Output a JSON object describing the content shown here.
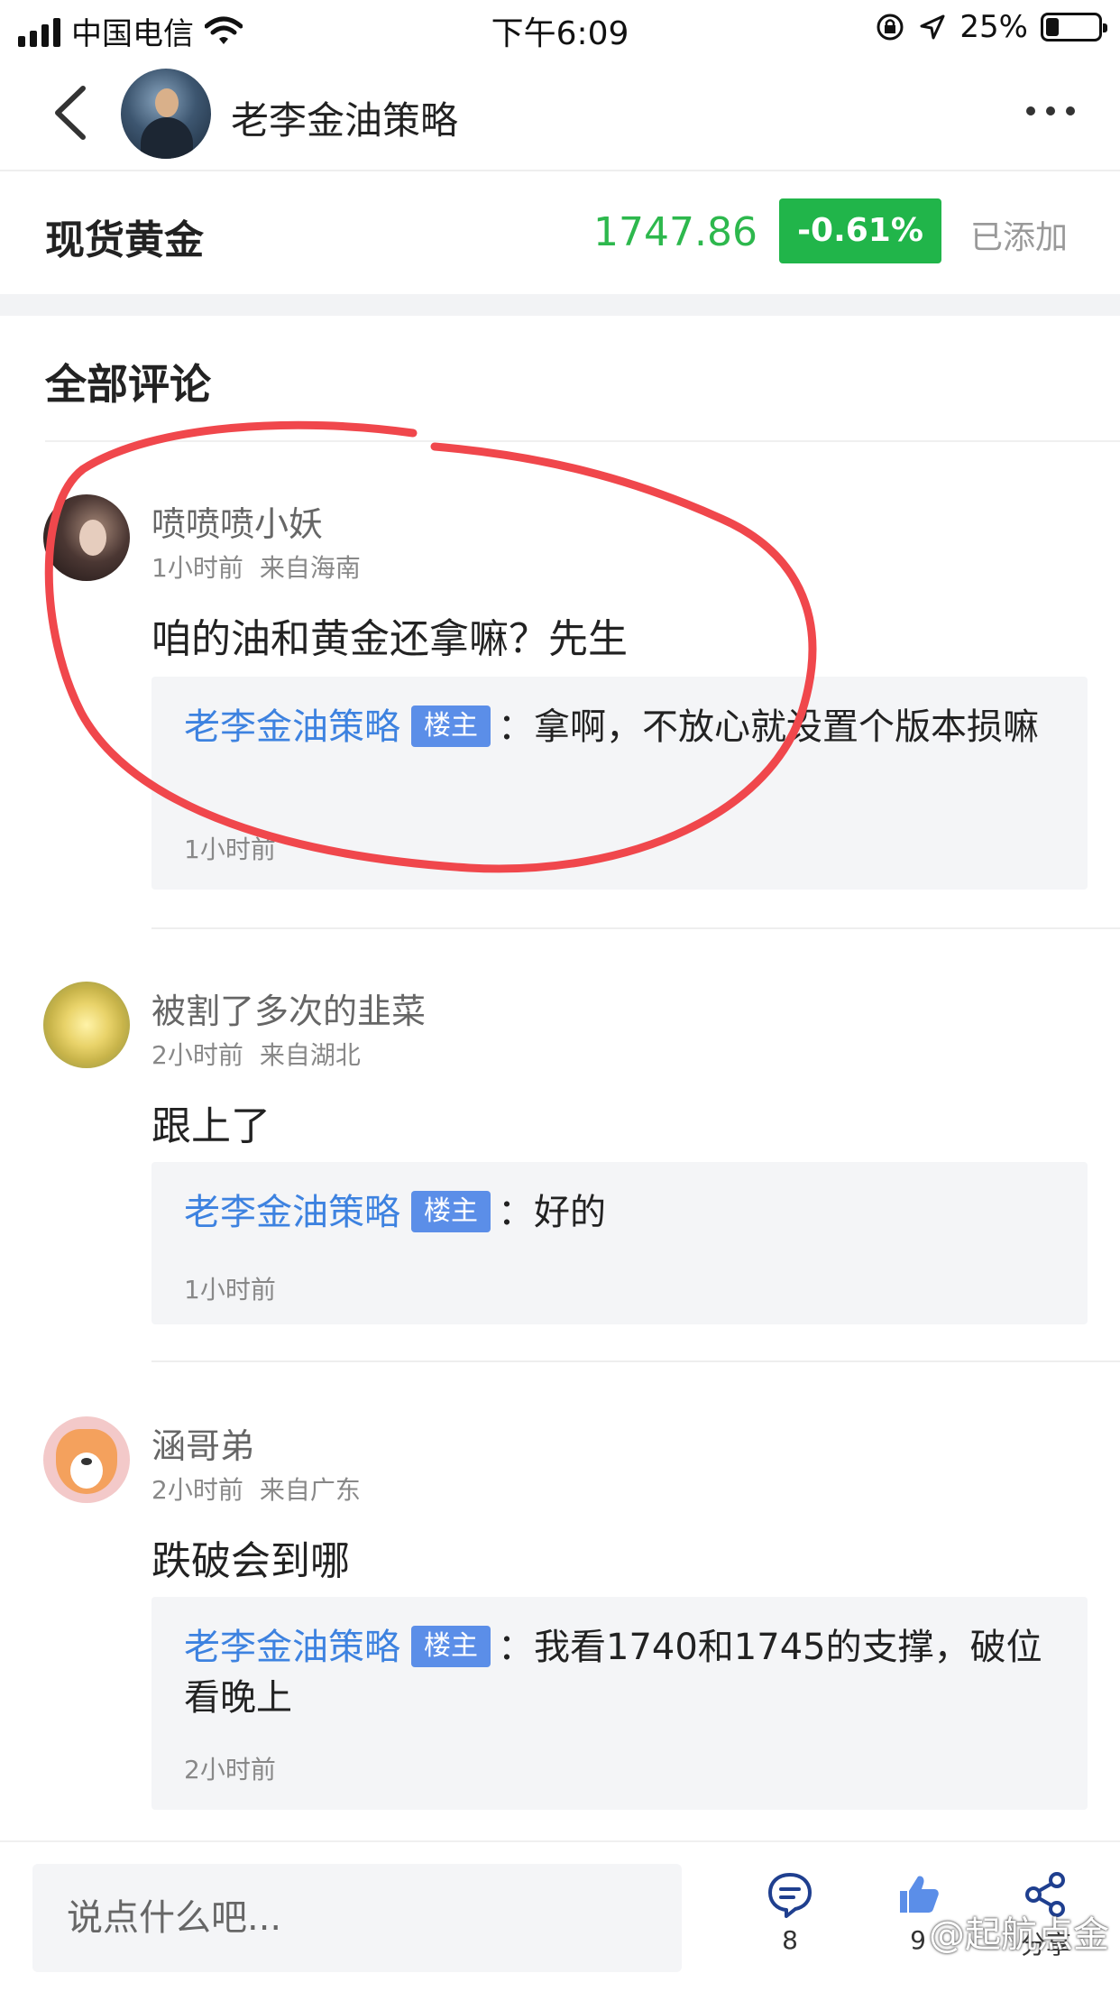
{
  "status_bar": {
    "carrier": "中国电信",
    "time": "下午6:09",
    "battery": "25%",
    "battery_level": 0.25
  },
  "header": {
    "title": "老李金油策略"
  },
  "ticker": {
    "name": "现货黄金",
    "price": "1747.86",
    "change": "-0.61%",
    "added_label": "已添加",
    "price_color": "#2db84d",
    "change_bg": "#21b54a"
  },
  "section": {
    "title": "全部评论"
  },
  "comments": [
    {
      "user": "喷喷喷小妖",
      "time": "1小时前",
      "location": "来自海南",
      "text": "咱的油和黄金还拿嘛？先生",
      "reply": {
        "author": "老李金油策略",
        "badge": "楼主",
        "sep": "：",
        "text": "拿啊，不放心就设置个版本损嘛",
        "time": "1小时前"
      }
    },
    {
      "user": "被割了多次的韭菜",
      "time": "2小时前",
      "location": "来自湖北",
      "text": "跟上了",
      "reply": {
        "author": "老李金油策略",
        "badge": "楼主",
        "sep": "：",
        "text": "好的",
        "time": "1小时前"
      }
    },
    {
      "user": "涵哥弟",
      "time": "2小时前",
      "location": "来自广东",
      "text": "跌破会到哪",
      "reply": {
        "author": "老李金油策略",
        "badge": "楼主",
        "sep": "：",
        "text": "我看1740和1745的支撑，破位看晚上",
        "time": "2小时前"
      }
    }
  ],
  "bottom_bar": {
    "input_placeholder": "说点什么吧...",
    "comment_count": "8",
    "like_count": "9",
    "share_label": "分享",
    "icon_color": "#1f3f8f"
  },
  "watermark": "@起航点金",
  "annotation_color": "#f0474c"
}
